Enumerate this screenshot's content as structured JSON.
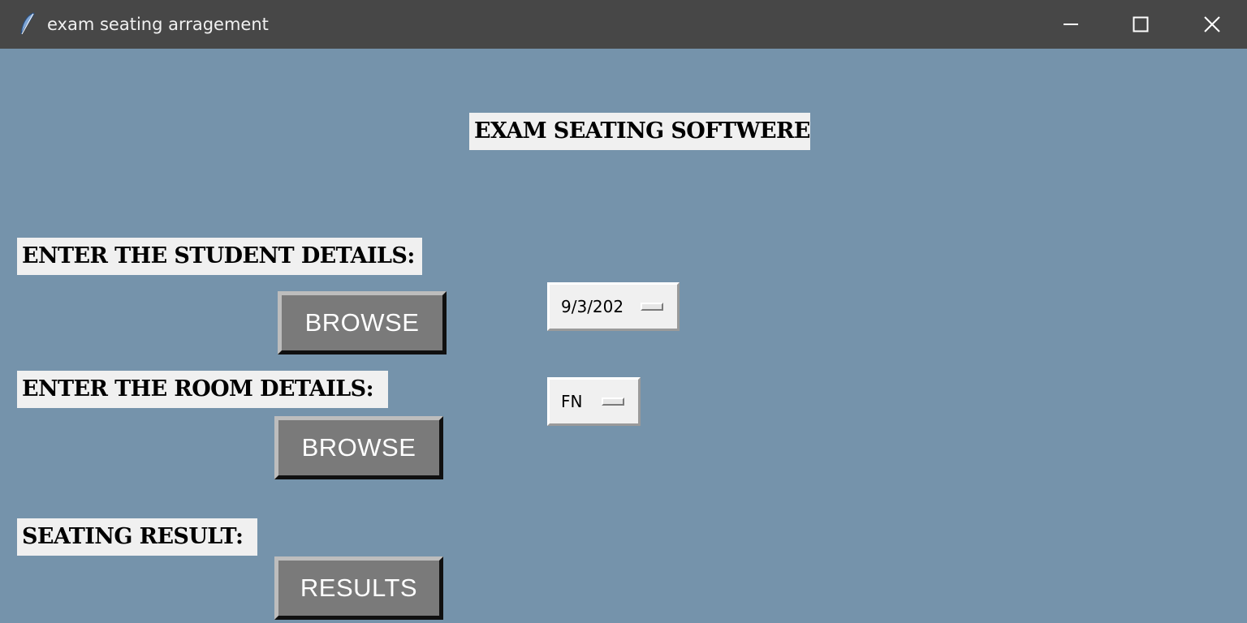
{
  "window": {
    "title": "exam seating arragement",
    "controls": {
      "minimize": "minimize-icon",
      "maximize": "maximize-icon",
      "close": "close-icon"
    }
  },
  "main": {
    "heading": "EXAM SEATING SOFTWERE",
    "student_section": {
      "label": "ENTER THE STUDENT DETAILS:",
      "button": "BROWSE"
    },
    "room_section": {
      "label": "ENTER THE ROOM DETAILS:",
      "button": "BROWSE"
    },
    "result_section": {
      "label": "SEATING RESULT:",
      "button": "RESULTS"
    },
    "date_select": {
      "value": "9/3/202"
    },
    "session_select": {
      "value": "FN"
    }
  },
  "colors": {
    "background": "#7593ab",
    "titlebar": "#474747",
    "label_bg": "#f0f0f0",
    "button_bg": "#7a7a7a",
    "button_text": "#ffffff"
  }
}
